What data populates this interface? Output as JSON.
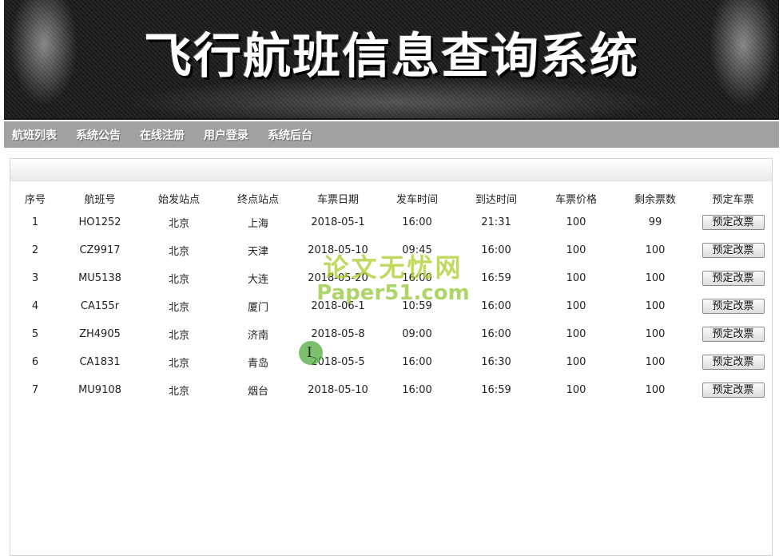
{
  "banner": {
    "title": "飞行航班信息查询系统"
  },
  "nav": [
    "航班列表",
    "系统公告",
    "在线注册",
    "用户登录",
    "系统后台"
  ],
  "table": {
    "headers": [
      "序号",
      "航班号",
      "始发站点",
      "终点站点",
      "车票日期",
      "发车时间",
      "到达时间",
      "车票价格",
      "剩余票数",
      "预定车票"
    ],
    "button_label": "预定改票",
    "rows": [
      [
        "1",
        "HO1252",
        "北京",
        "上海",
        "2018-05-1",
        "16:00",
        "21:31",
        "100",
        "99"
      ],
      [
        "2",
        "CZ9917",
        "北京",
        "天津",
        "2018-05-10",
        "09:45",
        "16:00",
        "100",
        "100"
      ],
      [
        "3",
        "MU5138",
        "北京",
        "大连",
        "2018-05-20",
        "16:00",
        "16:59",
        "100",
        "100"
      ],
      [
        "4",
        "CA155r",
        "北京",
        "厦门",
        "2018-06-1",
        "10:59",
        "16:00",
        "100",
        "100"
      ],
      [
        "5",
        "ZH4905",
        "北京",
        "济南",
        "2018-05-8",
        "09:00",
        "16:00",
        "100",
        "100"
      ],
      [
        "6",
        "CA1831",
        "北京",
        "青岛",
        "2018-05-5",
        "16:00",
        "16:30",
        "100",
        "100"
      ],
      [
        "7",
        "MU9108",
        "北京",
        "烟台",
        "2018-05-10",
        "16:00",
        "16:59",
        "100",
        "100"
      ]
    ]
  },
  "watermark": {
    "line1": "论文无忧网",
    "line2": "Paper51.com"
  },
  "cursor": {
    "glyph": "I"
  },
  "colors": {
    "navbar": "#a1a1a1",
    "banner": "#1c1c1c",
    "watermark": "#a8d028"
  }
}
